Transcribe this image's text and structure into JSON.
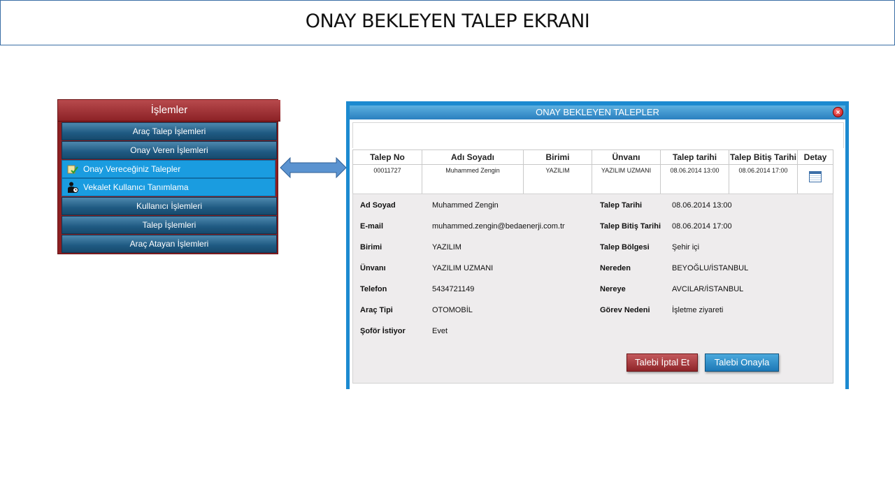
{
  "page_title": "ONAY BEKLEYEN TALEP EKRANI",
  "menu": {
    "header": "İşlemler",
    "items": [
      {
        "label": "Araç Talep İşlemleri"
      },
      {
        "label": "Onay Veren İşlemleri"
      },
      {
        "label": "Onay Vereceğiniz Talepler",
        "icon": "approve-icon"
      },
      {
        "label": "Vekalet Kullanıcı Tanımlama",
        "icon": "user-proxy-icon"
      },
      {
        "label": "Kullanıcı İşlemleri"
      },
      {
        "label": "Talep İşlemleri"
      },
      {
        "label": "Araç Atayan İşlemleri"
      }
    ]
  },
  "panel": {
    "title": "ONAY BEKLEYEN TALEPLER",
    "table": {
      "headers": [
        "Talep No",
        "Adı Soyadı",
        "Birimi",
        "Ünvanı",
        "Talep tarihi",
        "Talep Bitiş Tarihi",
        "Detay"
      ],
      "rows": [
        [
          "00011727",
          "Muhammed Zengin",
          "YAZILIM",
          "YAZILIM UZMANI",
          "08.06.2014 13:00",
          "08.06.2014 17:00"
        ]
      ]
    },
    "details": {
      "ad_soyad_label": "Ad Soyad",
      "ad_soyad": "Muhammed Zengin",
      "email_label": "E-mail",
      "email": "muhammed.zengin@bedaenerji.com.tr",
      "birimi_label": "Birimi",
      "birimi": "YAZILIM",
      "unvani_label": "Ünvanı",
      "unvani": "YAZILIM UZMANI",
      "telefon_label": "Telefon",
      "telefon": "5434721149",
      "arac_tipi_label": "Araç Tipi",
      "arac_tipi": "OTOMOBİL",
      "sofor_label": "Şoför İstiyor",
      "sofor": "Evet",
      "talep_tarihi_label": "Talep Tarihi",
      "talep_tarihi": "08.06.2014 13:00",
      "talep_bitis_label": "Talep Bitiş Tarihi",
      "talep_bitis": "08.06.2014 17:00",
      "talep_bolgesi_label": "Talep Bölgesi",
      "talep_bolgesi": "Şehir içi",
      "nereden_label": "Nereden",
      "nereden": "BEYOĞLU/İSTANBUL",
      "nereye_label": "Nereye",
      "nereye": "AVCILAR/İSTANBUL",
      "gorev_label": "Görev Nedeni",
      "gorev": "İşletme ziyareti"
    },
    "cancel_label": "Talebi İptal Et",
    "approve_label": "Talebi Onayla"
  },
  "colors": {
    "menu_red": "#8c1f22",
    "menu_blue": "#1f5a82",
    "active_blue": "#1a9ce0",
    "panel_blue": "#1c8ad0"
  }
}
